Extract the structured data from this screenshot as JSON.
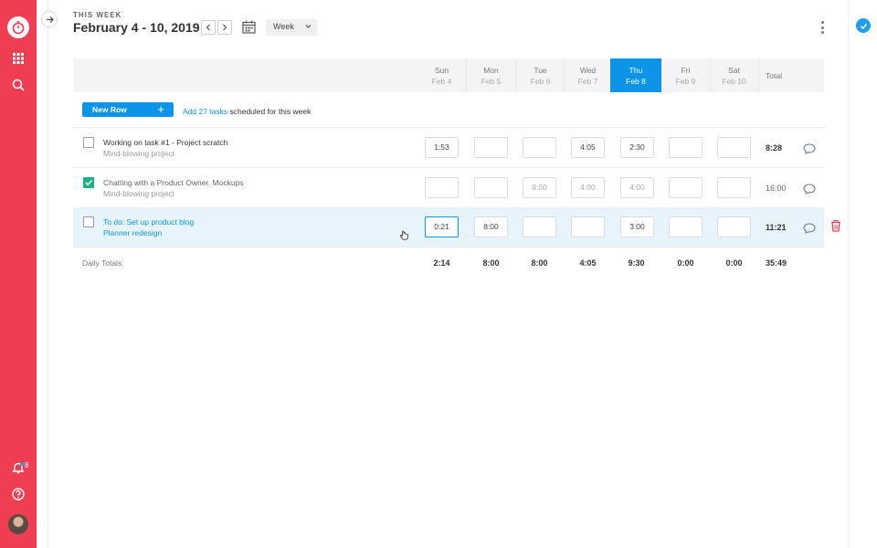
{
  "header": {
    "eyebrow": "THIS WEEK",
    "title": "February 4 - 10, 2019",
    "view": "Week",
    "nav": {
      "prev_icon": "chevron-left-icon",
      "next_icon": "chevron-right-icon",
      "calendar_icon": "calendar-icon"
    }
  },
  "sidebar": {
    "icons": [
      "timer-logo-icon",
      "apps-grid-icon",
      "search-icon",
      "bell-icon",
      "help-icon",
      "avatar"
    ],
    "notification_count": "8"
  },
  "table": {
    "days": [
      {
        "name": "Sun",
        "date": "Feb 4"
      },
      {
        "name": "Mon",
        "date": "Feb 5"
      },
      {
        "name": "Tue",
        "date": "Feb 6"
      },
      {
        "name": "Wed",
        "date": "Feb 7"
      },
      {
        "name": "Thu",
        "date": "Feb 8"
      },
      {
        "name": "Fri",
        "date": "Feb 9"
      },
      {
        "name": "Sat",
        "date": "Feb 10"
      }
    ],
    "selected_day": "Thu",
    "total_header": "Total",
    "new_row_label": "New Row",
    "add_tasks_link": "Add 27 tasks",
    "add_tasks_suffix": " scheduled for this week",
    "rows": [
      {
        "name": "Working on task #1 - Project scratch",
        "project": "Mind-blowing project",
        "checked": false,
        "values": [
          "1:53",
          "",
          "",
          "4:05",
          "2:30",
          "",
          ""
        ],
        "total": "8:28"
      },
      {
        "name": "Chatting with a Product Owner. Mockups",
        "project": "Mind-blowing project",
        "checked": true,
        "values": [
          "",
          "",
          "8:00",
          "4:00",
          "4:00",
          "",
          ""
        ],
        "total": "16:00"
      },
      {
        "name": "To do: Set up product blog",
        "project": "Planner redesign",
        "checked": false,
        "values": [
          "0:21",
          "8:00",
          "",
          "",
          "3:00",
          "",
          ""
        ],
        "total": "11:21"
      }
    ],
    "daily_totals_label": "Daily Totals:",
    "daily_totals": [
      "2:14",
      "8:00",
      "8:00",
      "4:05",
      "9:30",
      "0:00",
      "0:00"
    ],
    "grand_total": "35:49"
  },
  "colors": {
    "sidebar": "#ef3d51",
    "accent": "#0b94e8",
    "check": "#1bb38a",
    "trash": "#e5404f"
  }
}
